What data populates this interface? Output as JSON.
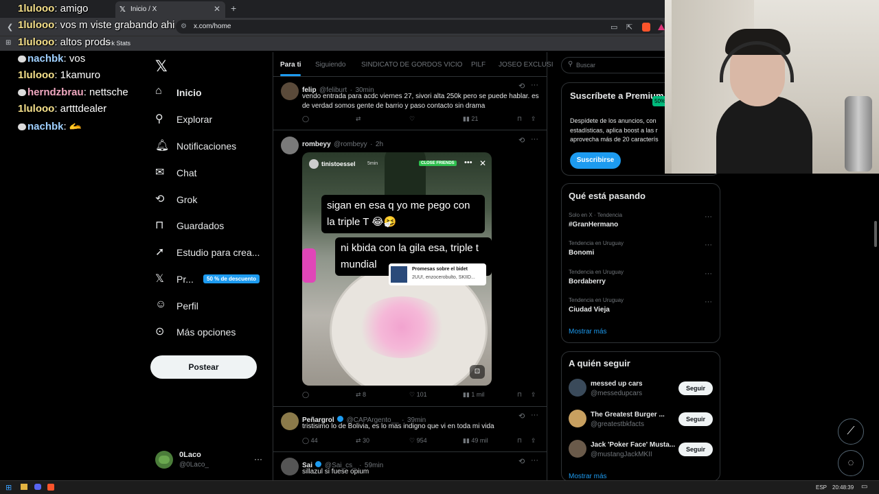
{
  "browser": {
    "tab_title": "Inicio / X",
    "url": "x.com/home",
    "bookmark_label": "Kick Stats"
  },
  "chat": [
    {
      "user": "1lulooo",
      "message": "amigo",
      "color": "#f5e08a"
    },
    {
      "user": "1lulooo",
      "message": "vos m viste grabando ahi",
      "color": "#f5e08a"
    },
    {
      "user": "1lulooo",
      "message": "altos prods",
      "color": "#f5e08a"
    },
    {
      "user": "nachbk",
      "message": "vos",
      "color": "#9fd0ff"
    },
    {
      "user": "1lulooo",
      "message": "1kamuro",
      "color": "#f5e08a"
    },
    {
      "user": "herndzbrau",
      "message": "nettsche",
      "color": "#f0a8c0"
    },
    {
      "user": "1lulooo",
      "message": "artttdealer",
      "color": "#f5e08a"
    },
    {
      "user": "nachbk",
      "message": "🫴",
      "color": "#9fd0ff"
    }
  ],
  "nav": {
    "items": [
      {
        "label": "Inicio",
        "icon": "home-icon"
      },
      {
        "label": "Explorar",
        "icon": "search-icon"
      },
      {
        "label": "Notificaciones",
        "icon": "bell-icon"
      },
      {
        "label": "Chat",
        "icon": "mail-icon"
      },
      {
        "label": "Grok",
        "icon": "grok-icon"
      },
      {
        "label": "Guardados",
        "icon": "bookmark-icon"
      },
      {
        "label": "Estudio para crea...",
        "icon": "rocket-icon"
      },
      {
        "label": "Pr...",
        "icon": "x-logo-icon"
      },
      {
        "label": "Perfil",
        "icon": "person-icon"
      },
      {
        "label": "Más opciones",
        "icon": "more-circle-icon"
      }
    ],
    "premium_discount": "50 % de descuento",
    "post_button": "Postear",
    "account_name": "0Laco",
    "account_handle": "@0Laco_"
  },
  "feed": {
    "tabs": [
      "Para ti",
      "Siguiendo",
      "SINDICATO DE GORDOS VICIO",
      "PILF",
      "JOSEO EXCLUSI"
    ],
    "tweets": [
      {
        "name": "felip",
        "handle": "@feliburt",
        "time": "30min",
        "text": "vendo entrada para acdc viernes 27, sivori alta 250k pero se puede hablar. es de verdad somos gente de barrio y paso contacto sin drama",
        "replies": "",
        "retweets": "",
        "likes": "",
        "views": "21"
      },
      {
        "name": "rombeyy",
        "handle": "@rombeyy",
        "time": "2h",
        "text": "",
        "replies": "",
        "retweets": "8",
        "likes": "101",
        "views": "1 mil",
        "media": {
          "story_user": "tinistoessel",
          "story_time": "5min",
          "close_friends": "CLOSE FRIENDS",
          "caption1": "sigan en esa q yo me pego con la triple T 😂🤧",
          "caption2": "ni kbida con la gila esa, triple t mundial",
          "music_title": "Promesas sobre el bidet",
          "music_artist": "2UU!, enzocerobulto, SKIID..."
        }
      },
      {
        "name": "Peñargrol",
        "handle": "@CAPArgento__",
        "time": "39min",
        "text": "tristisimo lo de Bolivia, es lo mas indigno que vi en toda mi vida",
        "replies": "44",
        "retweets": "30",
        "likes": "954",
        "views": "49 mil"
      },
      {
        "name": "Sai",
        "handle": "@Sai_cs_",
        "time": "59min",
        "text": "sillazul si fuese opium"
      }
    ]
  },
  "sidebar": {
    "search_placeholder": "Buscar",
    "premium": {
      "title": "Suscríbete a Premium",
      "badge": "50%",
      "body": "Despídete de los anuncios, con estadísticas, aplica boost a las r aprovecha más de 20 caracterís",
      "button": "Suscribirse"
    },
    "trends_title": "Qué está pasando",
    "trends": [
      {
        "meta": "Solo en X · Tendencia",
        "name": "#GranHermano"
      },
      {
        "meta": "Tendencia en Uruguay",
        "name": "Bonomi"
      },
      {
        "meta": "Tendencia en Uruguay",
        "name": "Bordaberry"
      },
      {
        "meta": "Tendencia en Uruguay",
        "name": "Ciudad Vieja"
      }
    ],
    "show_more": "Mostrar más",
    "follow_title": "A quién seguir",
    "follow": [
      {
        "name": "messed up cars",
        "handle": "@messedupcars"
      },
      {
        "name": "The Greatest Burger ...",
        "handle": "@greatestbkfacts"
      },
      {
        "name": "Jack 'Poker Face' Musta...",
        "handle": "@mustangJackMKII"
      }
    ],
    "follow_button": "Seguir",
    "show_more2": "Mostrar más"
  },
  "taskbar": {
    "lang": "ESP",
    "time": "20:48:39"
  }
}
